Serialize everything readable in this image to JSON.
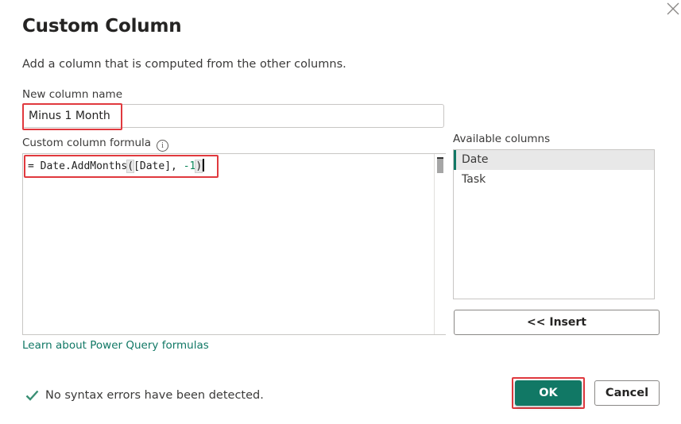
{
  "dialog": {
    "title": "Custom Column",
    "description": "Add a column that is computed from the other columns."
  },
  "new_column": {
    "label": "New column name",
    "value": "Minus 1 Month"
  },
  "formula": {
    "label": "Custom column formula",
    "info_icon": "info-icon",
    "prefix": "= Date.AddMonths",
    "open_paren": "(",
    "args_start": "[Date], ",
    "number": "-1",
    "close_paren": ")"
  },
  "available_columns": {
    "label": "Available columns",
    "items": [
      {
        "label": "Date",
        "selected": true
      },
      {
        "label": "Task",
        "selected": false
      }
    ],
    "insert_label": "<< Insert"
  },
  "learn_link": "Learn about Power Query formulas",
  "status": {
    "icon": "checkmark-icon",
    "text": "No syntax errors have been detected."
  },
  "buttons": {
    "ok": "OK",
    "cancel": "Cancel"
  },
  "colors": {
    "accent": "#117865",
    "highlight_box": "#e0393e"
  }
}
